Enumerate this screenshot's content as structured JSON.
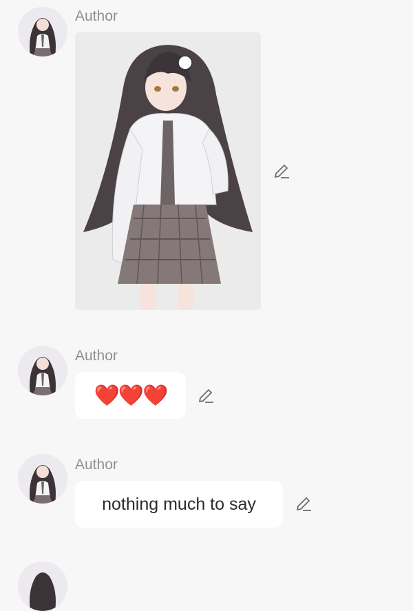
{
  "messages": [
    {
      "author": "Author",
      "type": "image",
      "image_alt": "anime girl illustration"
    },
    {
      "author": "Author",
      "type": "text",
      "text": "❤️❤️❤️"
    },
    {
      "author": "Author",
      "type": "text",
      "text": "nothing much to say"
    }
  ],
  "icons": {
    "edit": "pencil-edit-icon",
    "avatar": "avatar-anime-girl"
  },
  "colors": {
    "background": "#f7f7f7",
    "author": "#8f8f8f",
    "bubble": "#ffffff",
    "icon": "#6e6e6e",
    "heart": "#e01b24"
  }
}
